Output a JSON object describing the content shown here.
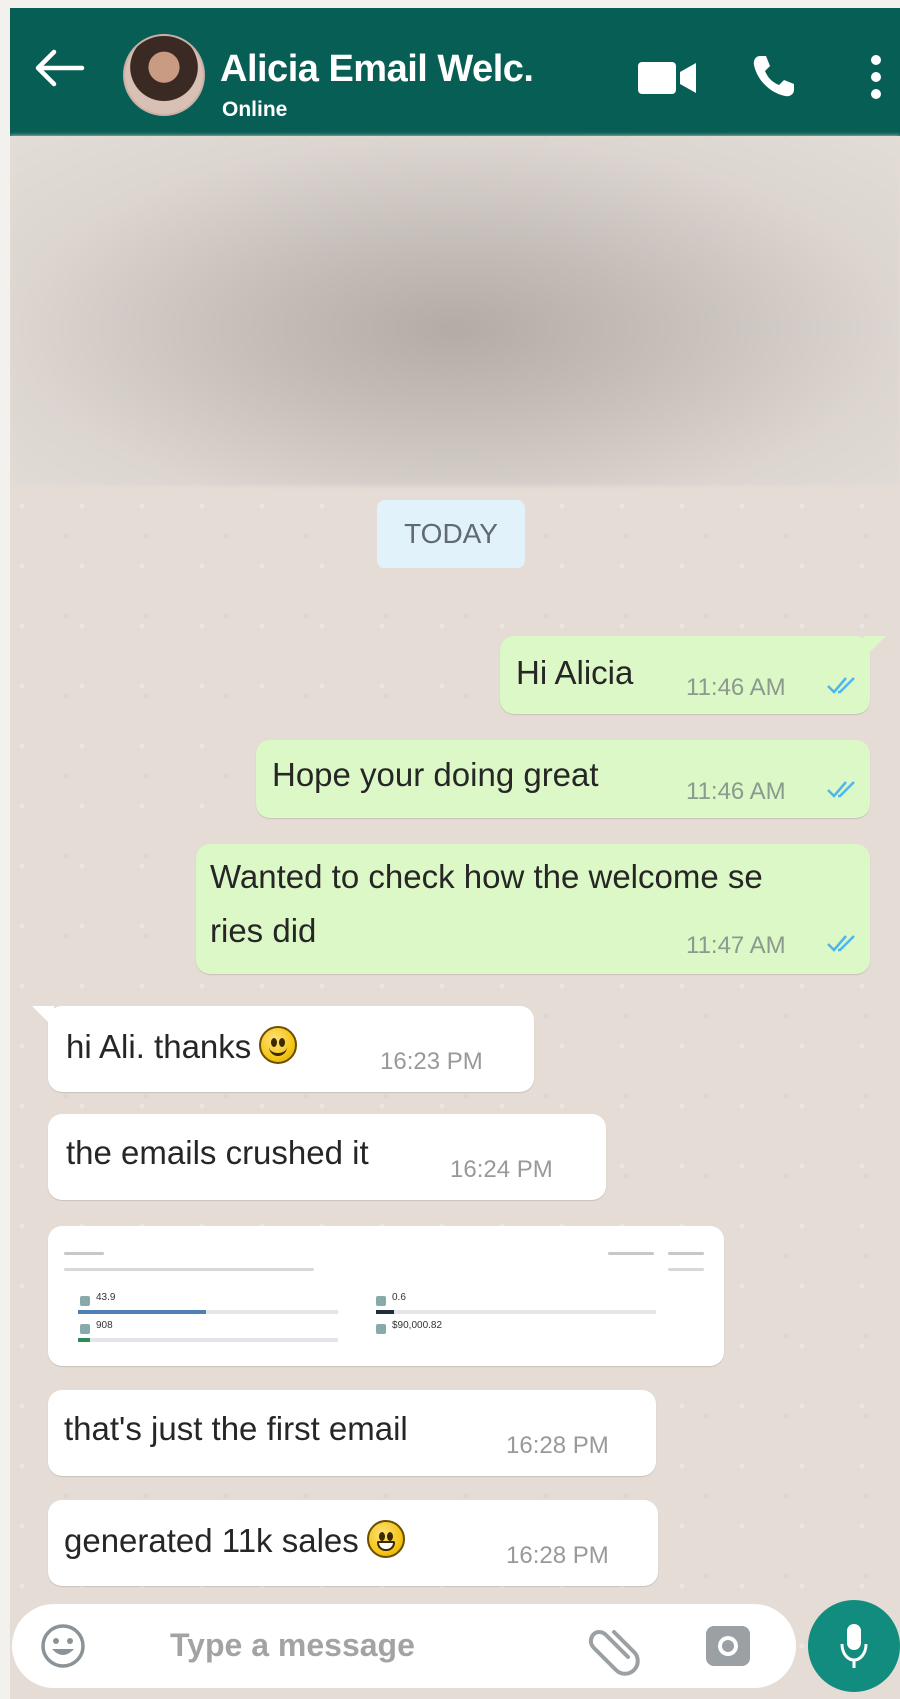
{
  "header": {
    "title": "Alicia Email Welc.",
    "status": "Online",
    "icons": [
      "back-arrow-icon",
      "video-call-icon",
      "phone-icon",
      "more-vert-icon"
    ]
  },
  "date_divider": "TODAY",
  "messages": [
    {
      "direction": "out",
      "text": "Hi Alicia",
      "time": "11:46 AM",
      "read": true
    },
    {
      "direction": "out",
      "text": "Hope your doing great",
      "time": "11:46 AM",
      "read": true
    },
    {
      "direction": "out",
      "text_line1": "Wanted to check how the welcome se",
      "text_line2": "ries did",
      "time": "11:47 AM",
      "read": true
    },
    {
      "direction": "in",
      "text": "hi Ali. thanks",
      "emoji": "smiley-emoji",
      "time": "16:23 PM"
    },
    {
      "direction": "in",
      "text": "the emails crushed it",
      "time": "16:24 PM"
    },
    {
      "direction": "in",
      "type": "image",
      "preview": {
        "stat1": "43.9",
        "stat2": "0.6",
        "stat3": "908",
        "stat4": "$90,000.82"
      }
    },
    {
      "direction": "in",
      "text": "that's just the first email",
      "time": "16:28 PM"
    },
    {
      "direction": "in",
      "text": "generated 11k sales",
      "emoji": "grin-emoji",
      "time": "16:28 PM"
    }
  ],
  "composer": {
    "placeholder": "Type a message",
    "icons": [
      "emoji-icon",
      "attach-icon",
      "camera-icon",
      "mic-icon"
    ]
  },
  "colors": {
    "header": "#075e54",
    "outgoing_bubble": "#dcf8c6",
    "incoming_bubble": "#ffffff",
    "wallpaper": "#e5ddd5",
    "date_chip": "#e1f2fb",
    "read_ticks": "#4fb6ec",
    "mic_button": "#128c7e"
  }
}
